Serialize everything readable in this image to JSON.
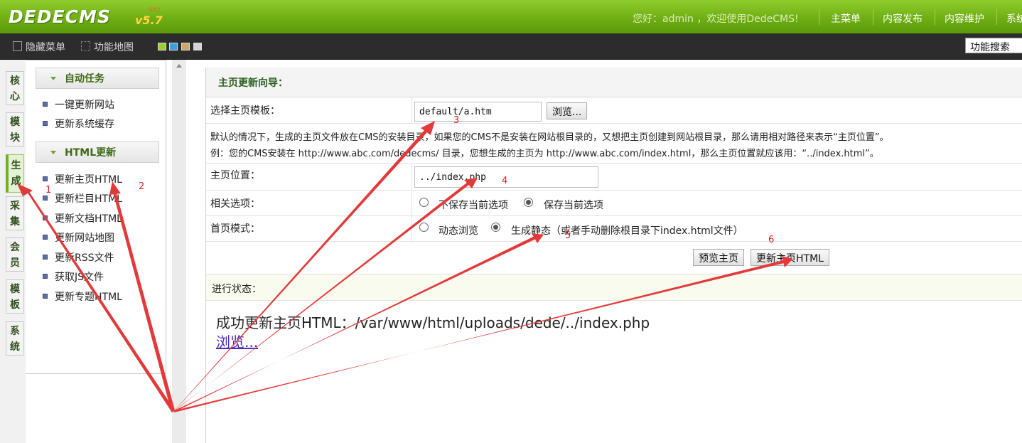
{
  "header": {
    "logo_text": "DEDECMS",
    "logo_version": "v5.7",
    "logo_sub": "SP2",
    "welcome": "您好：admin ，欢迎使用DedeCMS!",
    "nav": [
      "主菜单",
      "内容发布",
      "内容维护",
      "系统"
    ]
  },
  "toolbar": {
    "hide_menu": "隐藏菜单",
    "function_map": "功能地图",
    "search_placeholder": "功能搜索",
    "skin_colors": [
      "#9acd32",
      "#3aa0dd",
      "#c9a770",
      "#d5d5d5"
    ]
  },
  "sidebar_tabs": [
    "核心",
    "模块",
    "生成",
    "采集",
    "会员",
    "模板",
    "系统"
  ],
  "menu": {
    "sections": [
      {
        "title": "自动任务",
        "items": [
          "一键更新网站",
          "更新系统缓存"
        ]
      },
      {
        "title": "HTML更新",
        "items": [
          "更新主页HTML",
          "更新栏目HTML",
          "更新文档HTML",
          "更新网站地图",
          "更新RSS文件",
          "获取JS文件",
          "更新专题HTML"
        ]
      }
    ]
  },
  "form": {
    "title": "主页更新向导：",
    "template_label": "选择主页模板：",
    "template_value": "default/a.htm",
    "browse_button": "浏览...",
    "note_line1": "默认的情况下，生成的主页文件放在CMS的安装目录，如果您的CMS不是安装在网站根目录的，又想把主页创建到网站根目录，那么请用相对路径来表示“主页位置”。",
    "note_line2": "例：您的CMS安装在 http://www.abc.com/dedecms/ 目录，您想生成的主页为 http://www.abc.com/index.html，那么主页位置就应该用：“../index.html”。",
    "location_label": "主页位置：",
    "location_value": "../index.php",
    "options_label": "相关选项：",
    "option_no_save": "不保存当前选项",
    "option_save": "保存当前选项",
    "mode_label": "首页模式：",
    "mode_dynamic": "动态浏览",
    "mode_static": "生成静态（或者手动删除根目录下index.html文件）",
    "preview_button": "预览主页",
    "update_button": "更新主页HTML",
    "selected_option": "保存当前选项",
    "selected_mode": "生成静态"
  },
  "status": {
    "label": "进行状态：",
    "message": "成功更新主页HTML：/var/www/html/uploads/dede/../index.php",
    "link": "浏览..."
  },
  "annotations": [
    "1",
    "2",
    "3",
    "4",
    "5",
    "6"
  ],
  "annotation_color": "#e23a3a"
}
